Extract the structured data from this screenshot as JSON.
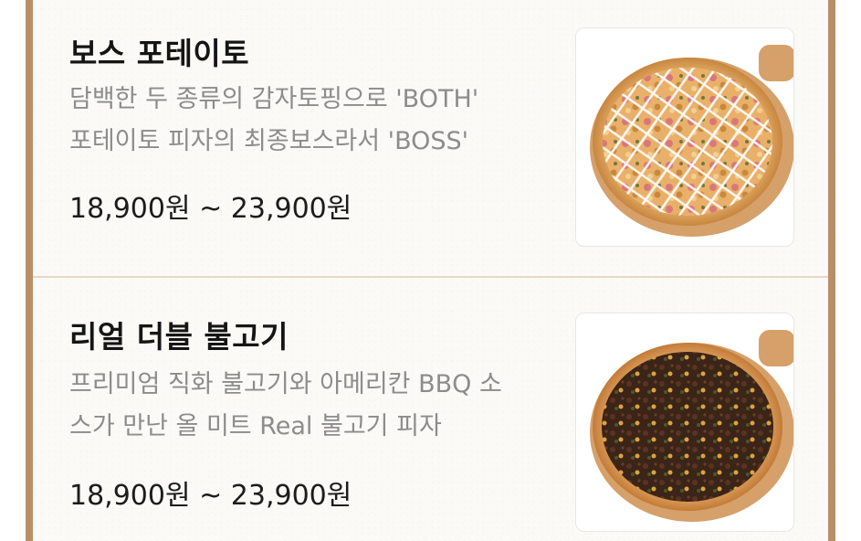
{
  "menu": {
    "items": [
      {
        "name": "보스 포테이토",
        "description": [
          "담백한 두 종류의 감자토핑으로 'BOTH'",
          "포테이토 피자의 최종보스라서 'BOSS'"
        ],
        "price": "18,900원 ~ 23,900원",
        "image_icon": "pizza-boss-potato-photo"
      },
      {
        "name": "리얼 더블 불고기",
        "description": [
          "프리미엄 직화 불고기와 아메리칸 BBQ 소",
          "스가 만난 올 미트 Real 불고기 피자"
        ],
        "price": "18,900원 ~ 23,900원",
        "image_icon": "pizza-bulgogi-photo"
      }
    ]
  },
  "colors": {
    "frame": "#b98f68",
    "divider": "#ead7c2",
    "title": "#151515",
    "description": "#8c8c8c",
    "price": "#1c1c1c"
  }
}
